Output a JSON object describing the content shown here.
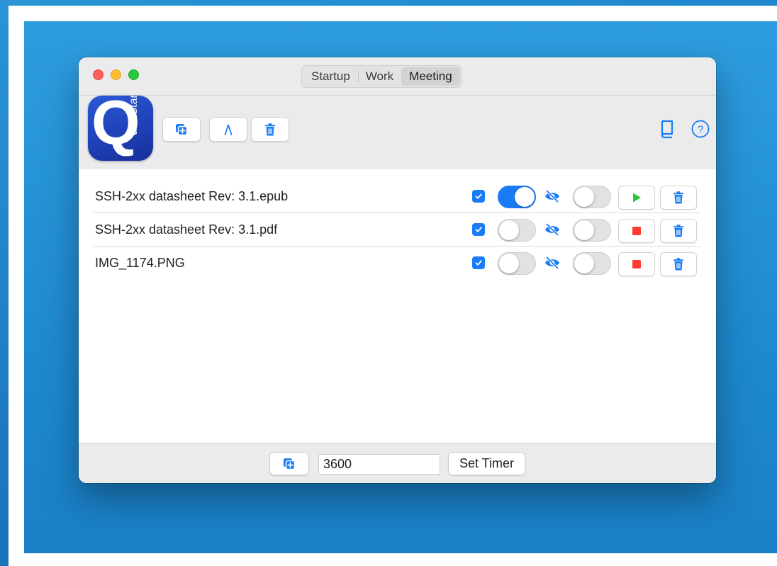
{
  "window": {
    "tabs": [
      {
        "label": "Startup",
        "active": false
      },
      {
        "label": "Work",
        "active": false
      },
      {
        "label": "Meeting",
        "active": true
      }
    ]
  },
  "app_icon": {
    "letter": "Q",
    "text": "uickStart"
  },
  "toolbar": {
    "buttons": [
      "add-icon",
      "launch-icon",
      "trash-icon"
    ],
    "right_icons": [
      "book-icon",
      "help-icon"
    ]
  },
  "items": [
    {
      "name": "SSH-2xx datasheet Rev: 3.1.epub",
      "checked": true,
      "open_toggle": true,
      "hide_toggle": false,
      "action": "play",
      "action_color": "#28c840"
    },
    {
      "name": "SSH-2xx datasheet Rev: 3.1.pdf",
      "checked": true,
      "open_toggle": false,
      "hide_toggle": false,
      "action": "stop",
      "action_color": "#ff3b30"
    },
    {
      "name": "IMG_1174.PNG",
      "checked": true,
      "open_toggle": false,
      "hide_toggle": false,
      "action": "stop",
      "action_color": "#ff3b30"
    }
  ],
  "footer": {
    "timer_value": "3600",
    "set_timer_label": "Set Timer"
  },
  "colors": {
    "accent": "#1a7cf5",
    "desktop": "#1e8ad0",
    "play": "#28c840",
    "stop": "#ff3b30"
  }
}
